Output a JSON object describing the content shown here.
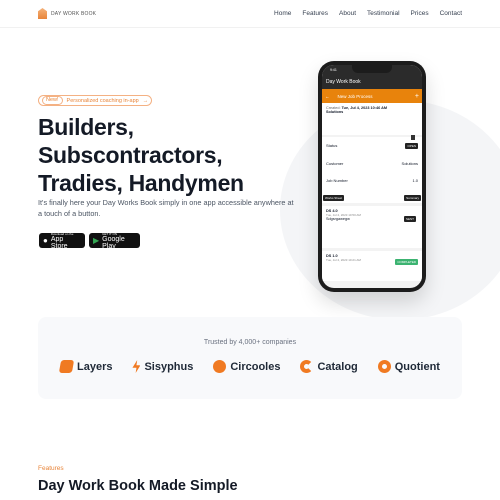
{
  "nav": {
    "logo": "DAY WORK BOOK",
    "items": [
      "Home",
      "Features",
      "About",
      "Testimonial",
      "Prices",
      "Contact"
    ]
  },
  "hero": {
    "badge_new": "New!",
    "badge_text": "Personalized coaching in-app",
    "badge_arrow": "→",
    "title_lines": [
      "Builders,",
      "Subscontractors,",
      "Tradies, Handymen"
    ],
    "subtitle": "It's finally here your Day Works Book simply in one app accessible anywhere at a touch of a button.",
    "appstore_small": "Download on the",
    "appstore": "App Store",
    "play_small": "GET IT ON",
    "play": "Google Play"
  },
  "phone": {
    "time": "9:41",
    "app_title": "Day Work Book",
    "screen_title": "New Job Process",
    "created_label": "Created:",
    "created": "Tue, Jul 4, 2023 10:46 AM",
    "company": "Solutions",
    "status_label": "Status",
    "status": "OPEN",
    "customer_label": "Customer",
    "customer": "Solutions",
    "job_label": "Job Number",
    "job": "1.0",
    "works_sheet": "Works Sheet",
    "summary": "Summary",
    "entries": [
      {
        "id": "DS 4.0",
        "date": "Tue, Jul 4, 2023 10:50 AM",
        "tag": "SENT",
        "note": "Sdgsrgawegw",
        "color": "#2b2b2b"
      },
      {
        "id": "DS 1.0",
        "date": "Tue, Jul 4, 2023 10:21 AM",
        "tag": "COMPLETED",
        "color": "#3cb371"
      }
    ]
  },
  "trusted": {
    "title": "Trusted by 4,000+ companies",
    "brands": [
      "Layers",
      "Sisyphus",
      "Circooles",
      "Catalog",
      "Quotient"
    ]
  },
  "features": {
    "label": "Features",
    "title": "Day Work Book Made Simple"
  },
  "colors": {
    "accent": "#e8853a",
    "app_orange": "#e8830c"
  }
}
